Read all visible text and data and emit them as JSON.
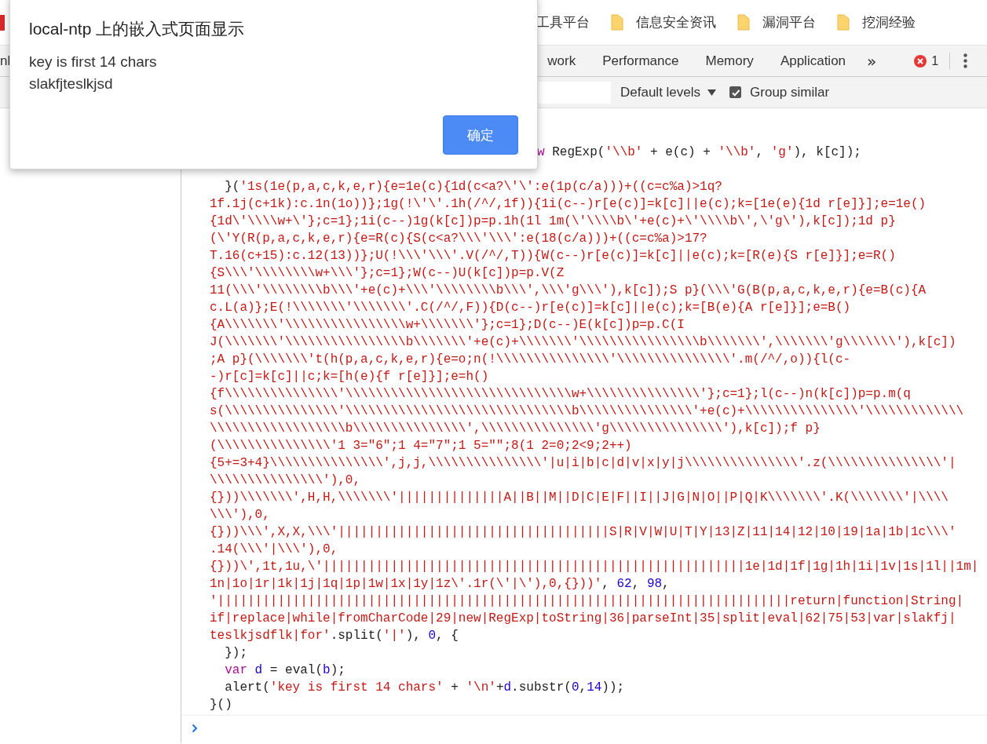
{
  "bookmarks": [
    {
      "label": "工具平台"
    },
    {
      "label": "信息安全资讯",
      "folder": true
    },
    {
      "label": "漏洞平台",
      "folder": true
    },
    {
      "label": "挖洞经验",
      "folder": true
    }
  ],
  "devtools": {
    "tabs": [
      {
        "label": "nl",
        "selected": false
      },
      {
        "label": "work",
        "selected": false
      },
      {
        "label": "Performance",
        "selected": false
      },
      {
        "label": "Memory",
        "selected": false
      },
      {
        "label": "Application",
        "selected": false
      }
    ],
    "more": "»",
    "error_count": "1"
  },
  "console_toolbar": {
    "levels": "Default levels",
    "group_similar": {
      "label": "Group similar",
      "checked": true
    }
  },
  "console": {
    "lines": [
      {
        "clipped": true,
        "segments": [
          {
            "kind": "kw",
            "text": "w"
          },
          {
            "kind": "plain",
            "text": " RegExp("
          },
          {
            "kind": "str",
            "text": "'\\\\b'"
          },
          {
            "kind": "plain",
            "text": " + e(c) + "
          },
          {
            "kind": "str",
            "text": "'\\\\b'"
          },
          {
            "kind": "plain",
            "text": ", "
          },
          {
            "kind": "str",
            "text": "'g'"
          },
          {
            "kind": "plain",
            "text": "), k[c]);"
          }
        ]
      },
      {
        "segments": [
          {
            "kind": "plain",
            "text": "  }("
          },
          {
            "kind": "str",
            "text": "'1s(1e(p,a,c,k,e,r){e=1e(c){1d(c<a?\\'\\':e(1p(c/a)))+((c=c%a)>1q?"
          }
        ]
      },
      {
        "segments": [
          {
            "kind": "str",
            "text": "1f.1j(c+1k):c.1n(1o))};1g(!\\'\\'.1h(/^/,1f)){1i(c--)r[e(c)]=k[c]||e(c);k=[1e(e){1d r[e]}];e=1e()"
          }
        ]
      },
      {
        "segments": [
          {
            "kind": "str",
            "text": "{1d\\'\\\\\\\\w+\\'};c=1};1i(c--)1g(k[c])p=p.1h(1l 1m(\\'\\\\\\\\b\\'+e(c)+\\'\\\\\\\\b\\',\\'g\\'),k[c]);1d p}"
          }
        ]
      },
      {
        "segments": [
          {
            "kind": "str",
            "text": "(\\'Y(R(p,a,c,k,e,r){e=R(c){S(c<a?\\\\\\'\\\\\\':e(18(c/a)))+((c=c%a)>17?"
          }
        ]
      },
      {
        "segments": [
          {
            "kind": "str",
            "text": "T.16(c+15):c.12(13))};U(!\\\\\\'\\\\\\'.V(/^/,T)){W(c--)r[e(c)]=k[c]||e(c);k=[R(e){S r[e]}];e=R()"
          }
        ]
      },
      {
        "segments": [
          {
            "kind": "str",
            "text": "{S\\\\\\'\\\\\\\\\\\\\\\\w+\\\\\\'};c=1};W(c--)U(k[c])p=p.V(Z"
          }
        ]
      },
      {
        "segments": [
          {
            "kind": "str",
            "text": "11(\\\\\\'\\\\\\\\\\\\\\\\b\\\\\\'+e(c)+\\\\\\'\\\\\\\\\\\\\\\\b\\\\\\',\\\\\\'g\\\\\\'),k[c]);S p}(\\\\\\'G(B(p,a,c,k,e,r){e=B(c){A"
          }
        ]
      },
      {
        "segments": [
          {
            "kind": "str",
            "text": "c.L(a)};E(!\\\\\\\\\\\\\\'\\\\\\\\\\\\\\'.C(/^/,F)){D(c--)r[e(c)]=k[c]||e(c);k=[B(e){A r[e]}];e=B()"
          }
        ]
      },
      {
        "segments": [
          {
            "kind": "str",
            "text": "{A\\\\\\\\\\\\\\'\\\\\\\\\\\\\\\\\\\\\\\\\\\\\\\\w+\\\\\\\\\\\\\\'};c=1};D(c--)E(k[c])p=p.C(I"
          }
        ]
      },
      {
        "segments": [
          {
            "kind": "str",
            "text": "J(\\\\\\\\\\\\\\'\\\\\\\\\\\\\\\\\\\\\\\\\\\\\\\\b\\\\\\\\\\\\\\'+e(c)+\\\\\\\\\\\\\\'\\\\\\\\\\\\\\\\\\\\\\\\\\\\\\\\b\\\\\\\\\\\\\\',\\\\\\\\\\\\\\'g\\\\\\\\\\\\\\'),k[c])"
          }
        ]
      },
      {
        "segments": [
          {
            "kind": "str",
            "text": ";A p}(\\\\\\\\\\\\\\'t(h(p,a,c,k,e,r){e=o;n(!\\\\\\\\\\\\\\\\\\\\\\\\\\\\\\'\\\\\\\\\\\\\\\\\\\\\\\\\\\\\\'.m(/^/,o)){l(c-"
          }
        ]
      },
      {
        "segments": [
          {
            "kind": "str",
            "text": "-)r[c]=k[c]||c;k=[h(e){f r[e]}];e=h()"
          }
        ]
      },
      {
        "segments": [
          {
            "kind": "str",
            "text": "{f\\\\\\\\\\\\\\\\\\\\\\\\\\\\\\'\\\\\\\\\\\\\\\\\\\\\\\\\\\\\\\\\\\\\\\\\\\\\\\\\\\\\\\\\\\\w+\\\\\\\\\\\\\\\\\\\\\\\\\\\\\\'};c=1};l(c--)n(k[c])p=p.m(q"
          }
        ]
      },
      {
        "segments": [
          {
            "kind": "str",
            "text": "s(\\\\\\\\\\\\\\\\\\\\\\\\\\\\\\'\\\\\\\\\\\\\\\\\\\\\\\\\\\\\\\\\\\\\\\\\\\\\\\\\\\\\\\\\\\\b\\\\\\\\\\\\\\\\\\\\\\\\\\\\\\'+e(c)+\\\\\\\\\\\\\\\\\\\\\\\\\\\\\\'\\\\\\\\\\\\\\\\\\\\\\\\\\"
          }
        ]
      },
      {
        "segments": [
          {
            "kind": "str",
            "text": "\\\\\\\\\\\\\\\\\\\\\\\\\\\\\\\\\\\\b\\\\\\\\\\\\\\\\\\\\\\\\\\\\\\',\\\\\\\\\\\\\\\\\\\\\\\\\\\\\\'g\\\\\\\\\\\\\\\\\\\\\\\\\\\\\\'),k[c]);f p}"
          }
        ]
      },
      {
        "segments": [
          {
            "kind": "str",
            "text": "(\\\\\\\\\\\\\\\\\\\\\\\\\\\\\\'1 3=\"6\";1 4=\"7\";1 5=\"\";8(1 2=0;2<9;2++)"
          }
        ]
      },
      {
        "segments": [
          {
            "kind": "str",
            "text": "{5+=3+4}\\\\\\\\\\\\\\\\\\\\\\\\\\\\\\',j,j,\\\\\\\\\\\\\\\\\\\\\\\\\\\\\\'|u|i|b|c|d|v|x|y|j\\\\\\\\\\\\\\\\\\\\\\\\\\\\\\'.z(\\\\\\\\\\\\\\\\\\\\\\\\\\\\\\'|"
          }
        ]
      },
      {
        "segments": [
          {
            "kind": "str",
            "text": "\\\\\\\\\\\\\\\\\\\\\\\\\\\\\\'),0,"
          }
        ]
      },
      {
        "segments": [
          {
            "kind": "str",
            "text": "{}))\\\\\\\\\\\\\\',H,H,\\\\\\\\\\\\\\'||||||||||||||A||B||M||D|C|E|F||I||J|G|N|O||P|Q|K\\\\\\\\\\\\\\'.K(\\\\\\\\\\\\\\'|\\\\\\\\"
          }
        ]
      },
      {
        "segments": [
          {
            "kind": "str",
            "text": "\\\\\\'),0,"
          }
        ]
      },
      {
        "segments": [
          {
            "kind": "str",
            "text": "{}))\\\\\\',X,X,\\\\\\'||||||||||||||||||||||||||||||||||||S|R|V|W|U|T|Y|13|Z|11|14|12|10|19|1a|1b|1c\\\\\\'"
          }
        ]
      },
      {
        "segments": [
          {
            "kind": "str",
            "text": ".14(\\\\\\'|\\\\\\'),0,"
          }
        ]
      },
      {
        "segments": [
          {
            "kind": "str",
            "text": "{}))\\',1t,1u,\\'||||||||||||||||||||||||||||||||||||||||||||||||||||||||1e|1d|1f|1g|1h|1i|1v|1s|1l||1m|"
          }
        ]
      },
      {
        "segments": [
          {
            "kind": "str",
            "text": "1n|1o|1r|1k|1j|1q|1p|1w|1x|1y|1z\\'.1r(\\'|\\'),0,{}))'"
          },
          {
            "kind": "plain",
            "text": ", "
          },
          {
            "kind": "num",
            "text": "62"
          },
          {
            "kind": "plain",
            "text": ", "
          },
          {
            "kind": "num",
            "text": "98"
          },
          {
            "kind": "plain",
            "text": ","
          }
        ]
      },
      {
        "segments": [
          {
            "kind": "str",
            "text": "'||||||||||||||||||||||||||||||||||||||||||||||||||||||||||||||||||||||||||||return|function|String|"
          }
        ]
      },
      {
        "segments": [
          {
            "kind": "str",
            "text": "if|replace|while|fromCharCode|29|new|RegExp|toString|36|parseInt|35|split|eval|62|75|53|var|slakfj|"
          }
        ]
      },
      {
        "segments": [
          {
            "kind": "str",
            "text": "teslkjsdflk|for'"
          },
          {
            "kind": "plain",
            "text": ".split("
          },
          {
            "kind": "str",
            "text": "'|'"
          },
          {
            "kind": "plain",
            "text": "), "
          },
          {
            "kind": "num",
            "text": "0"
          },
          {
            "kind": "plain",
            "text": ", {"
          }
        ]
      },
      {
        "segments": [
          {
            "kind": "plain",
            "text": "  });"
          }
        ]
      },
      {
        "segments": [
          {
            "kind": "kw",
            "text": "  var"
          },
          {
            "kind": "var",
            "text": " d"
          },
          {
            "kind": "plain",
            "text": " = eval("
          },
          {
            "kind": "var",
            "text": "b"
          },
          {
            "kind": "plain",
            "text": ");"
          }
        ]
      },
      {
        "segments": [
          {
            "kind": "plain",
            "text": "  alert("
          },
          {
            "kind": "str",
            "text": "'key is first 14 chars'"
          },
          {
            "kind": "plain",
            "text": " + "
          },
          {
            "kind": "str",
            "text": "'\\n'"
          },
          {
            "kind": "plain",
            "text": "+"
          },
          {
            "kind": "var",
            "text": "d"
          },
          {
            "kind": "plain",
            "text": ".substr("
          },
          {
            "kind": "num",
            "text": "0"
          },
          {
            "kind": "plain",
            "text": ","
          },
          {
            "kind": "num",
            "text": "14"
          },
          {
            "kind": "plain",
            "text": "));"
          }
        ]
      },
      {
        "segments": [
          {
            "kind": "plain",
            "text": "}()"
          }
        ]
      }
    ]
  },
  "dialog": {
    "title": "local-ntp 上的嵌入式页面显示",
    "message_lines": [
      "key is first 14 chars",
      "slakfjteslkjsd"
    ],
    "button": "确定"
  }
}
